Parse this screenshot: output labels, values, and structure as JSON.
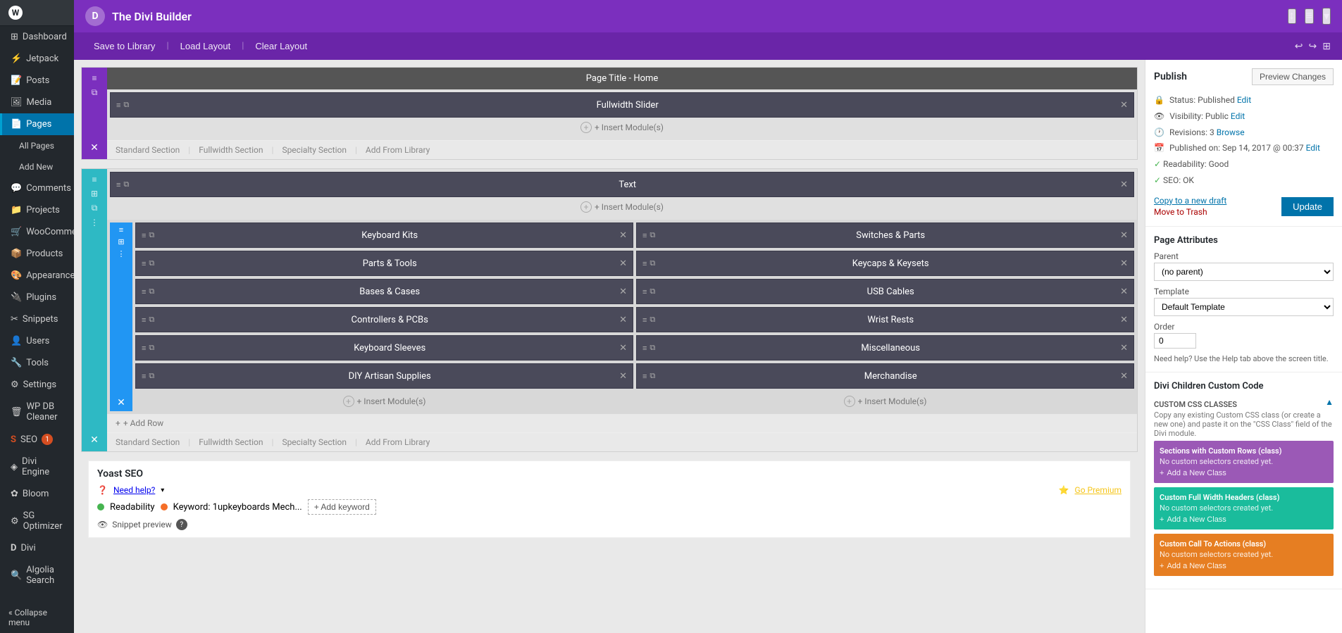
{
  "sidebar": {
    "logo": "W",
    "items": [
      {
        "label": "Dashboard",
        "icon": "⊞",
        "active": false
      },
      {
        "label": "Jetpack",
        "icon": "⚡",
        "active": false
      },
      {
        "label": "Posts",
        "icon": "📝",
        "active": false
      },
      {
        "label": "Media",
        "icon": "🖼",
        "active": false
      },
      {
        "label": "Pages",
        "icon": "📄",
        "active": true
      },
      {
        "label": "All Pages",
        "sub": true,
        "active": false
      },
      {
        "label": "Add New",
        "sub": true,
        "active": false
      },
      {
        "label": "Comments",
        "icon": "💬",
        "active": false
      },
      {
        "label": "Projects",
        "icon": "📁",
        "active": false
      },
      {
        "label": "WooCommerce",
        "icon": "🛒",
        "active": false
      },
      {
        "label": "Products",
        "icon": "📦",
        "active": false
      },
      {
        "label": "Appearance",
        "icon": "🎨",
        "active": false
      },
      {
        "label": "Plugins",
        "icon": "🔌",
        "active": false
      },
      {
        "label": "Snippets",
        "icon": "✂",
        "active": false
      },
      {
        "label": "Users",
        "icon": "👤",
        "active": false
      },
      {
        "label": "Tools",
        "icon": "🔧",
        "active": false
      },
      {
        "label": "Settings",
        "icon": "⚙",
        "active": false
      },
      {
        "label": "WP DB Cleaner",
        "icon": "🗑",
        "active": false
      },
      {
        "label": "SEO",
        "icon": "S",
        "active": false,
        "badge": "1"
      },
      {
        "label": "Divi Engine",
        "icon": "◈",
        "active": false
      },
      {
        "label": "Bloom",
        "icon": "✿",
        "active": false
      },
      {
        "label": "SG Optimizer",
        "icon": "⚙",
        "active": false
      },
      {
        "label": "Divi",
        "icon": "D",
        "active": false
      },
      {
        "label": "Algolia Search",
        "icon": "🔍",
        "active": false
      },
      {
        "label": "Collapse menu",
        "icon": "«",
        "active": false
      }
    ]
  },
  "divi_header": {
    "logo": "D",
    "title": "The Divi Builder",
    "icons": [
      "↕",
      "≡",
      "▾"
    ]
  },
  "toolbar": {
    "save_label": "Save to Library",
    "load_label": "Load Layout",
    "clear_label": "Clear Layout",
    "undo_icon": "↩",
    "redo_icon": "↪",
    "grid_icon": "⊞"
  },
  "builder": {
    "section1": {
      "page_title": "Page Title - Home",
      "module_title": "Fullwidth Slider"
    },
    "section2": {
      "module_title": "Text",
      "row_modules_left": [
        "Keyboard Kits",
        "Parts & Tools",
        "Bases & Cases",
        "Controllers & PCBs",
        "Keyboard Sleeves",
        "DIY Artisan Supplies"
      ],
      "row_modules_right": [
        "Switches & Parts",
        "Keycaps & Keysets",
        "USB Cables",
        "Wrist Rests",
        "Miscellaneous",
        "Merchandise"
      ]
    },
    "insert_module": "+ Insert Module(s)",
    "add_row": "+ Add Row",
    "section_links": {
      "standard": "Standard Section",
      "fullwidth": "Fullwidth Section",
      "specialty": "Specialty Section",
      "add_from_library": "Add From Library"
    }
  },
  "publish": {
    "title": "Publish",
    "preview_btn": "Preview Changes",
    "status_label": "Status:",
    "status_value": "Published",
    "status_link": "Edit",
    "visibility_label": "Visibility:",
    "visibility_value": "Public",
    "visibility_link": "Edit",
    "revisions_label": "Revisions:",
    "revisions_value": "3",
    "revisions_link": "Browse",
    "published_label": "Published on:",
    "published_value": "Sep 14, 2017 @ 00:37",
    "published_link": "Edit",
    "readability_label": "Readability:",
    "readability_value": "Good",
    "seo_label": "SEO:",
    "seo_value": "OK",
    "copy_draft": "Copy to a new draft",
    "move_trash": "Move to Trash",
    "update_btn": "Update"
  },
  "page_attributes": {
    "title": "Page Attributes",
    "parent_label": "Parent",
    "parent_value": "(no parent)",
    "template_label": "Template",
    "template_value": "Default Template",
    "order_label": "Order",
    "order_value": "0",
    "help_text": "Need help? Use the Help tab above the screen title."
  },
  "divi_children": {
    "title": "Divi Children Custom Code",
    "subtitle": "CUSTOM CSS CLASSES",
    "description": "Copy any existing Custom CSS class (or create a new one) and paste it on the \"CSS Class\" field of the Divi module.",
    "classes": [
      {
        "title": "Sections with Custom Rows (class)",
        "text": "No custom selectors created yet.",
        "add_label": "Add a New Class",
        "color": "purple"
      },
      {
        "title": "Custom Full Width Headers (class)",
        "text": "No custom selectors created yet.",
        "add_label": "Add a New Class",
        "color": "teal"
      },
      {
        "title": "Custom Call To Actions (class)",
        "text": "No custom selectors created yet.",
        "add_label": "Add a New Class",
        "color": "orange"
      }
    ]
  },
  "yoast": {
    "title": "Yoast SEO",
    "need_help": "Need help?",
    "go_premium": "Go Premium",
    "readability_label": "Readability",
    "keyword_label": "Keyword: 1upkeyboards Mech...",
    "add_keyword": "+ Add keyword",
    "snippet_preview": "Snippet preview",
    "help_icon": "?"
  }
}
